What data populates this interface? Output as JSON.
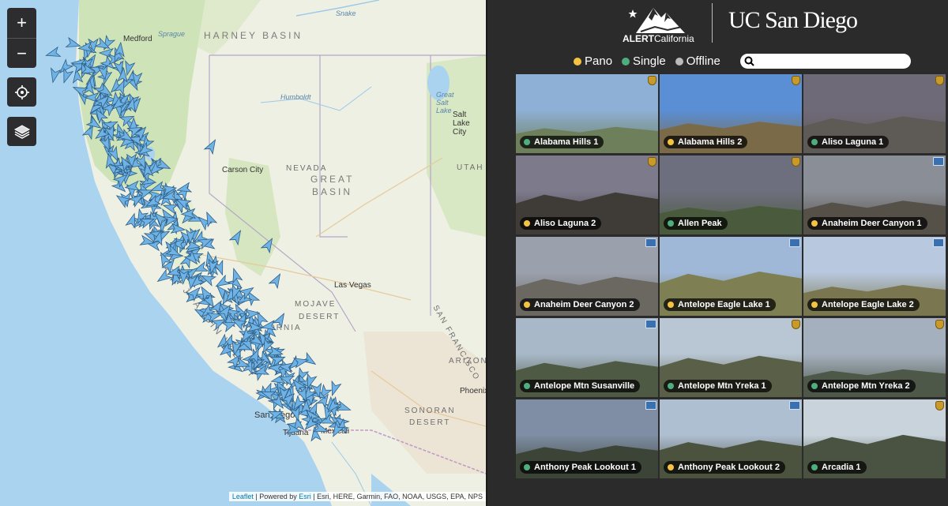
{
  "map": {
    "zoom_in_label": "+",
    "zoom_out_label": "−",
    "locate_icon": "crosshair-icon",
    "layers_icon": "layers-icon",
    "labels": {
      "harney_basin": "HARNEY BASIN",
      "medford": "Medford",
      "nevada": "NEVADA",
      "great": "GREAT",
      "basin": "BASIN",
      "carson_city": "Carson City",
      "utah": "UTAH",
      "great_salt_lake": "Great Salt Lake",
      "salt_lake_city": "Salt Lake City",
      "san_joaquin_valley": "SAN JOAQUIN VALLEY",
      "las_vegas": "Las Vegas",
      "mojave": "MOJAVE",
      "desert": "DESERT",
      "ornia": "ORNIA",
      "arizona": "ARIZONA",
      "phoenix": "Phoenix",
      "san_francisco": "SAN FRANCISCO",
      "sonoran": "SONORAN",
      "sonoran_desert": "DESERT",
      "san_diego": "San Diego",
      "tijuana": "Tijuana",
      "mexicali": "Mexicali",
      "humboldt": "Humboldt",
      "snake": "Snake",
      "sprague": "Sprague"
    },
    "attribution": {
      "leaflet": "Leaflet",
      "powered_by": "| Powered by",
      "esri": "Esri",
      "sources": "| Esri, HERE, Garmin, FAO, NOAA, USGS, EPA, NPS"
    },
    "marker_color": "#6fb3e6"
  },
  "header": {
    "alert_bold": "ALERT",
    "alert_rest": "California",
    "ucsd": "UC San Diego"
  },
  "legend": {
    "pano": {
      "label": "Pano",
      "color": "#f5c242"
    },
    "single": {
      "label": "Single",
      "color": "#4fae7e"
    },
    "offline": {
      "label": "Offline",
      "color": "#bbbbbb"
    }
  },
  "search": {
    "placeholder": "",
    "value": ""
  },
  "cameras": [
    {
      "name": "Alabama Hills 1",
      "status": "single"
    },
    {
      "name": "Alabama Hills 2",
      "status": "pano"
    },
    {
      "name": "Aliso Laguna 1",
      "status": "single"
    },
    {
      "name": "Aliso Laguna 2",
      "status": "pano"
    },
    {
      "name": "Allen Peak",
      "status": "single"
    },
    {
      "name": "Anaheim Deer Canyon 1",
      "status": "pano"
    },
    {
      "name": "Anaheim Deer Canyon 2",
      "status": "pano"
    },
    {
      "name": "Antelope Eagle Lake 1",
      "status": "pano"
    },
    {
      "name": "Antelope Eagle Lake 2",
      "status": "pano"
    },
    {
      "name": "Antelope Mtn Susanville",
      "status": "single"
    },
    {
      "name": "Antelope Mtn Yreka 1",
      "status": "single"
    },
    {
      "name": "Antelope Mtn Yreka 2",
      "status": "single"
    },
    {
      "name": "Anthony Peak Lookout 1",
      "status": "single"
    },
    {
      "name": "Anthony Peak Lookout 2",
      "status": "pano"
    },
    {
      "name": "Arcadia 1",
      "status": "single"
    }
  ]
}
